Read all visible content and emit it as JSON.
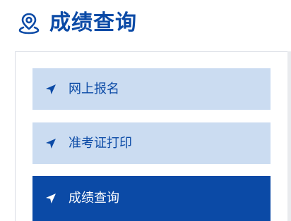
{
  "header": {
    "icon": "location-pin-icon",
    "title": "成绩查询"
  },
  "menu": {
    "items": [
      {
        "label": "网上报名",
        "icon": "navigation-arrow-icon",
        "active": false
      },
      {
        "label": "准考证打印",
        "icon": "navigation-arrow-icon",
        "active": false
      },
      {
        "label": "成绩查询",
        "icon": "navigation-arrow-icon",
        "active": true
      }
    ]
  },
  "colors": {
    "primary": "#0b4aa6",
    "item_background": "#cbdcf1",
    "active_text": "#ffffff"
  }
}
